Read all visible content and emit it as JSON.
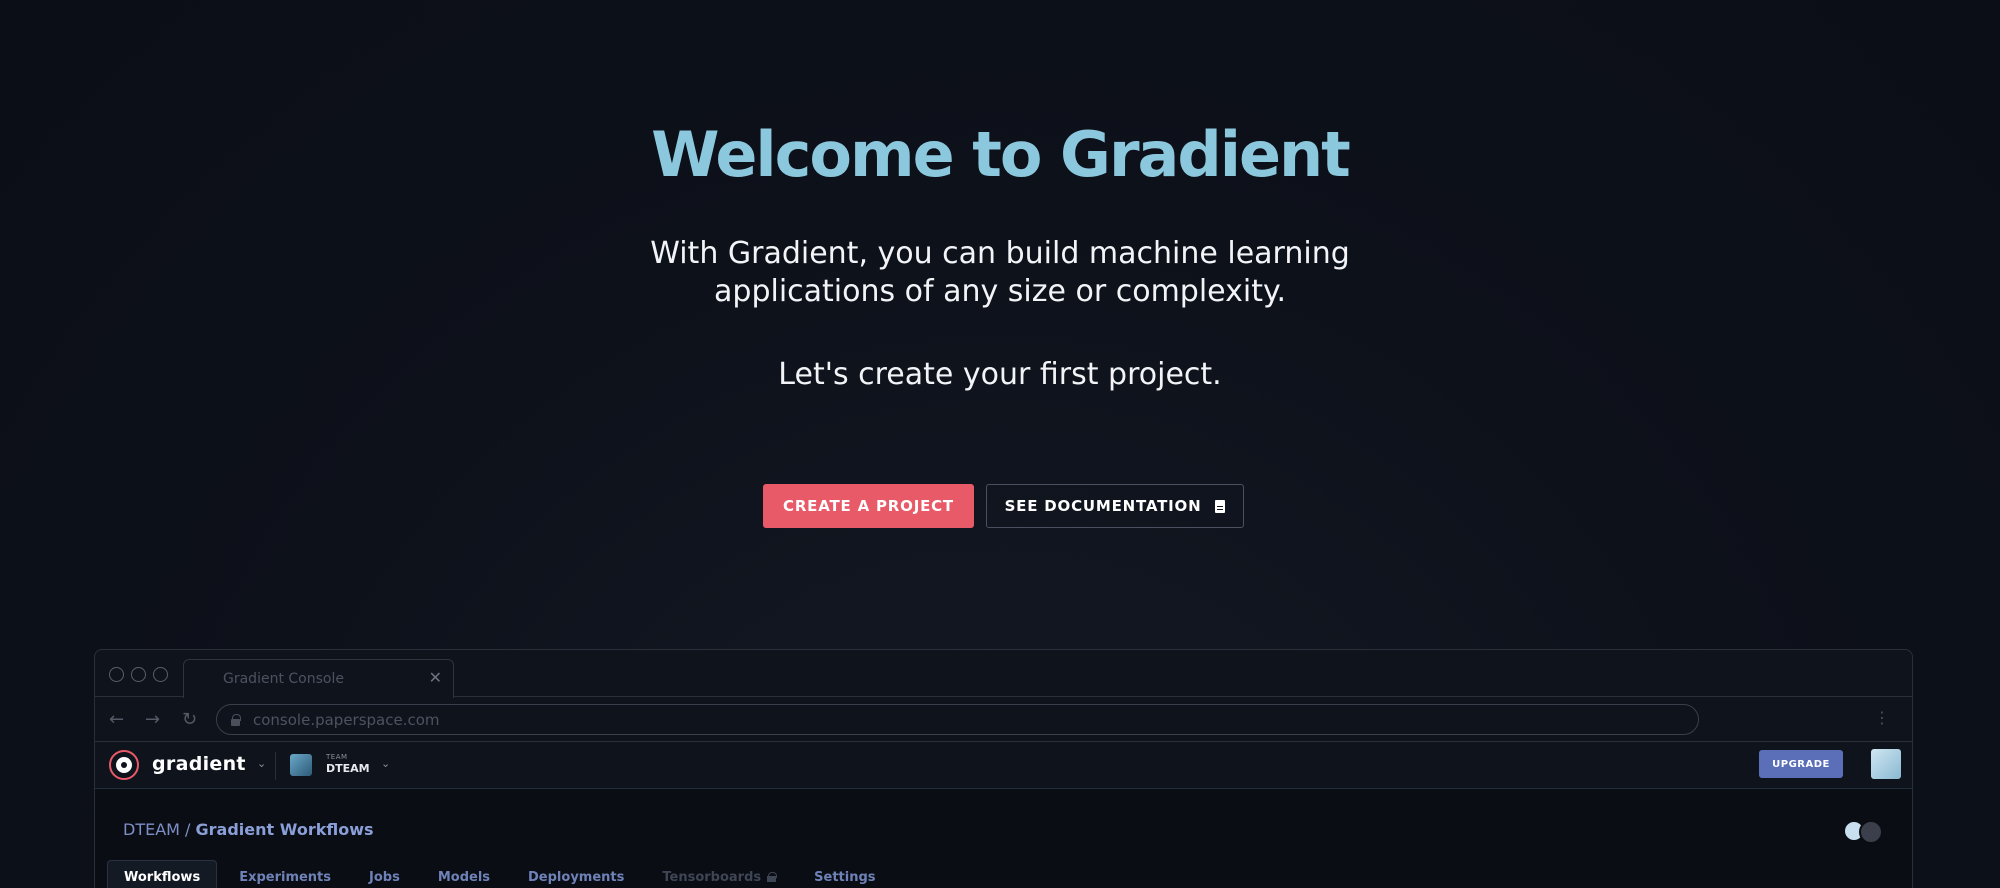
{
  "hero": {
    "title": "Welcome to Gradient",
    "subtitle_line1": "With Gradient, you can build machine learning",
    "subtitle_line2": "applications of any size or complexity.",
    "cta_text": "Let's create your first project.",
    "primary_button": "CREATE A PROJECT",
    "secondary_button": "SEE DOCUMENTATION",
    "secondary_button_icon": "document-icon"
  },
  "browser": {
    "tab_title": "Gradient Console",
    "url": "console.paperspace.com"
  },
  "app": {
    "logo_text": "gradient",
    "team_label": "TEAM",
    "team_name": "DTEAM",
    "upgrade_label": "UPGRADE",
    "breadcrumb_team": "DTEAM",
    "breadcrumb_separator": "/",
    "breadcrumb_project": "Gradient Workflows",
    "tabs": [
      {
        "label": "Workflows",
        "state": "active"
      },
      {
        "label": "Experiments",
        "state": "normal"
      },
      {
        "label": "Jobs",
        "state": "normal"
      },
      {
        "label": "Models",
        "state": "normal"
      },
      {
        "label": "Deployments",
        "state": "normal"
      },
      {
        "label": "Tensorboards",
        "state": "locked"
      },
      {
        "label": "Settings",
        "state": "normal"
      }
    ]
  },
  "colors": {
    "background": "#0d111a",
    "title": "#8cc8dd",
    "primary_button": "#e85a68",
    "upgrade_button": "#5a6fb8",
    "tab_link": "#6f82b8"
  }
}
